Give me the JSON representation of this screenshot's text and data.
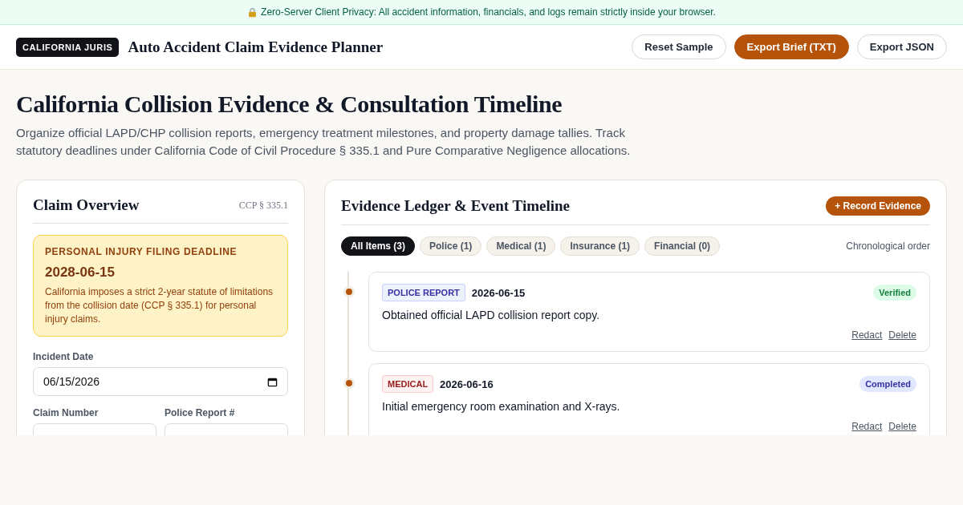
{
  "banner": {
    "text": "Zero-Server Client Privacy: All accident information, financials, and logs remain strictly inside your browser."
  },
  "header": {
    "brand": "CALIFORNIA JURIS",
    "title": "Auto Accident Claim Evidence Planner",
    "buttons": [
      {
        "label": "Reset Sample",
        "kind": "outline"
      },
      {
        "label": "Export Brief (TXT)",
        "kind": "primary"
      },
      {
        "label": "Export JSON",
        "kind": "outline"
      }
    ]
  },
  "page": {
    "title": "California Collision Evidence & Consultation Timeline",
    "subtitle": "Organize official LAPD/CHP collision reports, emergency treatment milestones, and property damage tallies. Track statutory deadlines under California Code of Civil Procedure § 335.1 and Pure Comparative Negligence allocations."
  },
  "overview": {
    "title": "Claim Overview",
    "code": "CCP § 335.1",
    "deadline": {
      "label": "PERSONAL INJURY FILING DEADLINE",
      "date": "2028-06-15",
      "note": "California imposes a strict 2-year statute of limitations from the collision date (CCP § 335.1) for personal injury claims."
    },
    "incident_date": {
      "label": "Incident Date",
      "value": "06/15/2026"
    },
    "claim_number": {
      "label": "Claim Number"
    },
    "police_report": {
      "label": "Police Report #"
    }
  },
  "ledger": {
    "title": "Evidence Ledger & Event Timeline",
    "add_button": "+ Record Evidence",
    "filters": [
      {
        "label": "All Items (3)",
        "selected": true
      },
      {
        "label": "Police (1)",
        "selected": false
      },
      {
        "label": "Medical (1)",
        "selected": false
      },
      {
        "label": "Insurance (1)",
        "selected": false
      },
      {
        "label": "Financial (0)",
        "selected": false
      }
    ],
    "order": "Chronological order",
    "entries": [
      {
        "kind": "police",
        "tag": "POLICE REPORT",
        "date": "2026-06-15",
        "status": {
          "label": "Verified",
          "kind": "verified"
        },
        "text": "Obtained official LAPD collision report copy.",
        "actions": [
          "Redact",
          "Delete"
        ]
      },
      {
        "kind": "medical",
        "tag": "MEDICAL",
        "date": "2026-06-16",
        "status": {
          "label": "Completed",
          "kind": "completed"
        },
        "text": "Initial emergency room examination and X-rays.",
        "actions": [
          "Redact",
          "Delete"
        ]
      }
    ]
  }
}
